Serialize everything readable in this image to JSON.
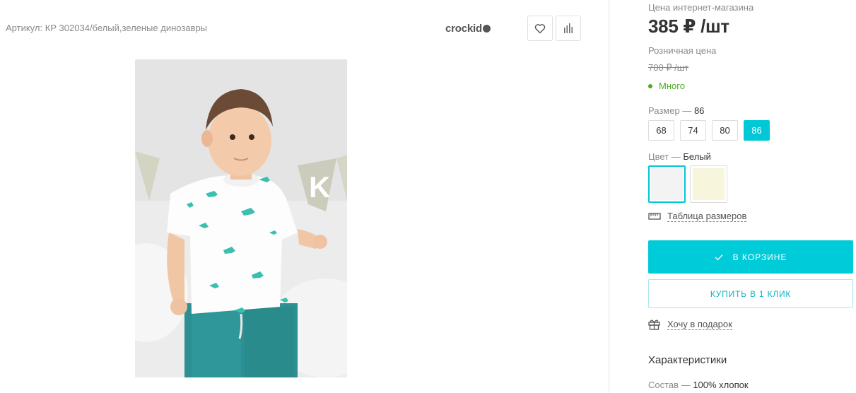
{
  "product": {
    "article_label": "Артикул:",
    "article_value": "КР 302034/белый,зеленые динозавры",
    "brand": "crockid"
  },
  "actions": {
    "favorite_icon": "heart-icon",
    "compare_icon": "bar-chart-icon"
  },
  "pricing": {
    "online_label": "Цена интернет-магазина",
    "online_price": "385 ₽ /шт",
    "retail_label": "Розничная цена",
    "retail_price": "700 ₽ /шт",
    "stock": "Много",
    "stock_color": "#4fa825"
  },
  "size": {
    "label": "Размер",
    "dash": "—",
    "selected": "86",
    "options": [
      "68",
      "74",
      "80",
      "86"
    ]
  },
  "color": {
    "label": "Цвет",
    "dash": "—",
    "selected": "Белый",
    "swatches": [
      "#f3f3f3",
      "#f7f6dc"
    ]
  },
  "size_table_link": "Таблица размеров",
  "buttons": {
    "in_cart": "В КОРЗИНЕ",
    "buy_one_click": "КУПИТЬ В 1 КЛИК"
  },
  "gift_link": "Хочу в подарок",
  "characteristics": {
    "title": "Характеристики",
    "rows": [
      {
        "label": "Состав",
        "dash": "—",
        "value": "100% хлопок"
      }
    ]
  },
  "colors": {
    "accent": "#00cbd9",
    "accent_border": "#a8e6ec"
  }
}
